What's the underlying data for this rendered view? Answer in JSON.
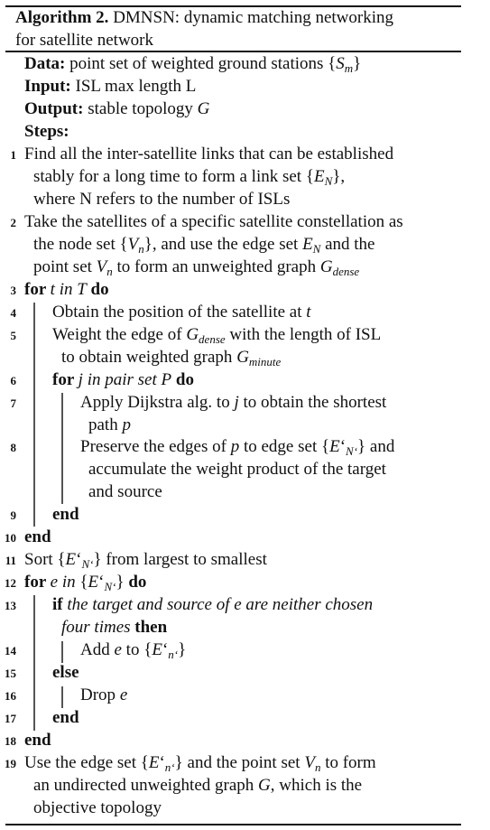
{
  "title": {
    "label": "Algorithm 2.",
    "line1": " DMNSN: dynamic matching networking",
    "line2": "for satellite network"
  },
  "lines": [
    {
      "n": "",
      "segs": [
        {
          "t": "Data:",
          "s": "b"
        },
        {
          "t": " point set of weighted ground stations {",
          "s": ""
        },
        {
          "t": "S",
          "s": "i"
        },
        {
          "t": "m",
          "s": "sub"
        },
        {
          "t": "}",
          "s": ""
        }
      ]
    },
    {
      "n": "",
      "segs": [
        {
          "t": "Input:",
          "s": "b"
        },
        {
          "t": " ISL max length L",
          "s": ""
        }
      ]
    },
    {
      "n": "",
      "segs": [
        {
          "t": "Output:",
          "s": "b"
        },
        {
          "t": " stable topology ",
          "s": ""
        },
        {
          "t": "G",
          "s": "i"
        }
      ]
    },
    {
      "n": "",
      "segs": [
        {
          "t": "Steps:",
          "s": "b"
        }
      ]
    },
    {
      "n": "1",
      "segs": [
        {
          "t": "Find all the inter-satellite links that can be established",
          "s": ""
        }
      ]
    },
    {
      "n": "",
      "segs": [
        {
          "t": "stably for a long time to form a link set {",
          "s": ""
        },
        {
          "t": "E",
          "s": "i"
        },
        {
          "t": "N",
          "s": "sub"
        },
        {
          "t": "},",
          "s": ""
        }
      ]
    },
    {
      "n": "",
      "segs": [
        {
          "t": "where N refers to the number of ISLs",
          "s": ""
        }
      ]
    },
    {
      "n": "2",
      "segs": [
        {
          "t": "Take the satellites of a specific satellite constellation as",
          "s": ""
        }
      ]
    },
    {
      "n": "",
      "segs": [
        {
          "t": "the node set {",
          "s": ""
        },
        {
          "t": "V",
          "s": "i"
        },
        {
          "t": "n",
          "s": "sub"
        },
        {
          "t": "}, and use the edge set ",
          "s": ""
        },
        {
          "t": "E",
          "s": "i"
        },
        {
          "t": "N",
          "s": "sub"
        },
        {
          "t": " and the",
          "s": ""
        }
      ]
    },
    {
      "n": "",
      "segs": [
        {
          "t": "point set ",
          "s": ""
        },
        {
          "t": "V",
          "s": "i"
        },
        {
          "t": "n",
          "s": "sub"
        },
        {
          "t": " to form an unweighted graph ",
          "s": ""
        },
        {
          "t": "G",
          "s": "i"
        },
        {
          "t": "dense",
          "s": "sub"
        }
      ]
    },
    {
      "n": "3",
      "segs": [
        {
          "t": "for ",
          "s": "b"
        },
        {
          "t": "t in T",
          "s": "i"
        },
        {
          "t": " do",
          "s": "b"
        }
      ]
    },
    {
      "n": "4",
      "segs": [
        {
          "t": "Obtain the position of the satellite at ",
          "s": ""
        },
        {
          "t": "t",
          "s": "i"
        }
      ]
    },
    {
      "n": "5",
      "segs": [
        {
          "t": "Weight the edge of ",
          "s": ""
        },
        {
          "t": "G",
          "s": "i"
        },
        {
          "t": "dense",
          "s": "sub"
        },
        {
          "t": " with the length of ISL",
          "s": ""
        }
      ]
    },
    {
      "n": "",
      "segs": [
        {
          "t": "to obtain weighted graph ",
          "s": ""
        },
        {
          "t": "G",
          "s": "i"
        },
        {
          "t": "minute",
          "s": "sub"
        }
      ]
    },
    {
      "n": "6",
      "segs": [
        {
          "t": "for ",
          "s": "b"
        },
        {
          "t": "j in pair set P",
          "s": "i"
        },
        {
          "t": " do",
          "s": "b"
        }
      ]
    },
    {
      "n": "7",
      "segs": [
        {
          "t": "Apply Dijkstra alg. to ",
          "s": ""
        },
        {
          "t": "j",
          "s": "i"
        },
        {
          "t": " to obtain the shortest",
          "s": ""
        }
      ]
    },
    {
      "n": "",
      "segs": [
        {
          "t": "path ",
          "s": ""
        },
        {
          "t": "p",
          "s": "i"
        }
      ]
    },
    {
      "n": "8",
      "segs": [
        {
          "t": "Preserve the edges of ",
          "s": ""
        },
        {
          "t": "p",
          "s": "i"
        },
        {
          "t": " to edge set {",
          "s": ""
        },
        {
          "t": "E",
          "s": "i"
        },
        {
          "t": "‘",
          "s": ""
        },
        {
          "t": "N‘",
          "s": "sub"
        },
        {
          "t": "} and",
          "s": ""
        }
      ]
    },
    {
      "n": "",
      "segs": [
        {
          "t": "accumulate the weight product of the target",
          "s": ""
        }
      ]
    },
    {
      "n": "",
      "segs": [
        {
          "t": "and source",
          "s": ""
        }
      ]
    },
    {
      "n": "9",
      "segs": [
        {
          "t": "end",
          "s": "b"
        }
      ]
    },
    {
      "n": "10",
      "segs": [
        {
          "t": "end",
          "s": "b"
        }
      ]
    },
    {
      "n": "11",
      "segs": [
        {
          "t": "Sort {",
          "s": ""
        },
        {
          "t": "E",
          "s": "i"
        },
        {
          "t": "‘",
          "s": ""
        },
        {
          "t": "N‘",
          "s": "sub"
        },
        {
          "t": "} from largest to smallest",
          "s": ""
        }
      ]
    },
    {
      "n": "12",
      "segs": [
        {
          "t": "for ",
          "s": "b"
        },
        {
          "t": "e in ",
          "s": "i"
        },
        {
          "t": "{",
          "s": ""
        },
        {
          "t": "E",
          "s": "i"
        },
        {
          "t": "‘",
          "s": ""
        },
        {
          "t": "N‘",
          "s": "sub"
        },
        {
          "t": "}",
          "s": ""
        },
        {
          "t": " do",
          "s": "b"
        }
      ]
    },
    {
      "n": "13",
      "segs": [
        {
          "t": "if ",
          "s": "b"
        },
        {
          "t": "the target and source of e are neither chosen",
          "s": "i"
        }
      ]
    },
    {
      "n": "",
      "segs": [
        {
          "t": "four times",
          "s": "i"
        },
        {
          "t": " then",
          "s": "b"
        }
      ]
    },
    {
      "n": "14",
      "segs": [
        {
          "t": "Add ",
          "s": ""
        },
        {
          "t": "e",
          "s": "i"
        },
        {
          "t": " to {",
          "s": ""
        },
        {
          "t": "E",
          "s": "i"
        },
        {
          "t": "‘",
          "s": ""
        },
        {
          "t": "n‘",
          "s": "sub"
        },
        {
          "t": "}",
          "s": ""
        }
      ]
    },
    {
      "n": "15",
      "segs": [
        {
          "t": "else",
          "s": "b"
        }
      ]
    },
    {
      "n": "16",
      "segs": [
        {
          "t": "Drop ",
          "s": ""
        },
        {
          "t": "e",
          "s": "i"
        }
      ]
    },
    {
      "n": "17",
      "segs": [
        {
          "t": "end",
          "s": "b"
        }
      ]
    },
    {
      "n": "18",
      "segs": [
        {
          "t": "end",
          "s": "b"
        }
      ]
    },
    {
      "n": "19",
      "segs": [
        {
          "t": "Use the edge set {",
          "s": ""
        },
        {
          "t": "E",
          "s": "i"
        },
        {
          "t": "‘",
          "s": ""
        },
        {
          "t": "n‘",
          "s": "sub"
        },
        {
          "t": "} and the point set ",
          "s": ""
        },
        {
          "t": "V",
          "s": "i"
        },
        {
          "t": "n",
          "s": "sub"
        },
        {
          "t": " to form",
          "s": ""
        }
      ]
    },
    {
      "n": "",
      "segs": [
        {
          "t": "an undirected unweighted graph ",
          "s": ""
        },
        {
          "t": "G",
          "s": "i"
        },
        {
          "t": ", which is the",
          "s": ""
        }
      ]
    },
    {
      "n": "",
      "segs": [
        {
          "t": "objective topology",
          "s": ""
        }
      ]
    }
  ]
}
